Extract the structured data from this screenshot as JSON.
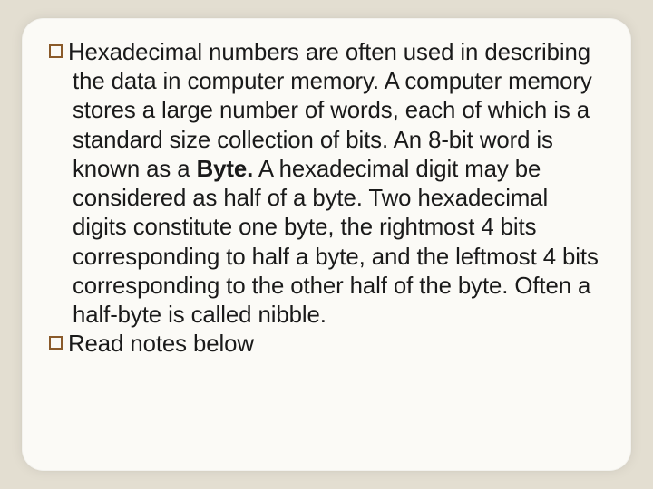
{
  "slide": {
    "items": [
      {
        "prefix": "Hexadecimal numbers are often used in describing the data in computer memory. A computer memory stores a large number of words, each of which is a standard size collection of bits. An 8-bit word is known as a ",
        "bold": "Byte.",
        "suffix": " A hexadecimal digit may be considered as half of a byte. Two hexadecimal digits constitute one byte, the rightmost 4 bits corresponding to half a byte, and the leftmost 4 bits corresponding to the other half of the byte. Often a half-byte is called nibble."
      },
      {
        "prefix": "Read notes below",
        "bold": "",
        "suffix": ""
      }
    ]
  }
}
